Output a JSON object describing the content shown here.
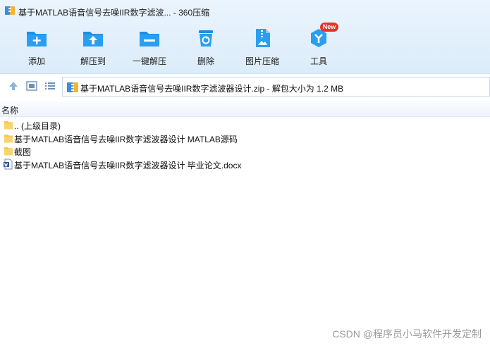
{
  "window": {
    "title": "基于MATLAB语音信号去噪IIR数字滤波... - 360压缩"
  },
  "toolbar": {
    "items": [
      {
        "label": "添加",
        "icon": "add-folder-icon"
      },
      {
        "label": "解压到",
        "icon": "extract-to-icon"
      },
      {
        "label": "一键解压",
        "icon": "one-click-extract-icon"
      },
      {
        "label": "删除",
        "icon": "delete-icon"
      },
      {
        "label": "图片压缩",
        "icon": "image-compress-icon"
      },
      {
        "label": "工具",
        "icon": "tools-icon",
        "badge": "New"
      }
    ]
  },
  "address": {
    "path": "基于MATLAB语音信号去噪IIR数字滤波器设计.zip - 解包大小为 1.2 MB"
  },
  "list": {
    "column_name": "名称",
    "rows": [
      {
        "name": ".. (上级目录)",
        "icon": "folder-icon"
      },
      {
        "name": "基于MATLAB语音信号去噪IIR数字滤波器设计 MATLAB源码",
        "icon": "folder-icon"
      },
      {
        "name": "截图",
        "icon": "folder-icon"
      },
      {
        "name": "基于MATLAB语音信号去噪IIR数字滤波器设计 毕业论文.docx",
        "icon": "word-doc-icon"
      }
    ]
  },
  "watermark": "CSDN @程序员小马软件开发定制",
  "colors": {
    "toolbar_blue": "#1d8fe0",
    "badge_red": "#e8322a",
    "folder_yellow": "#f6c94f"
  }
}
